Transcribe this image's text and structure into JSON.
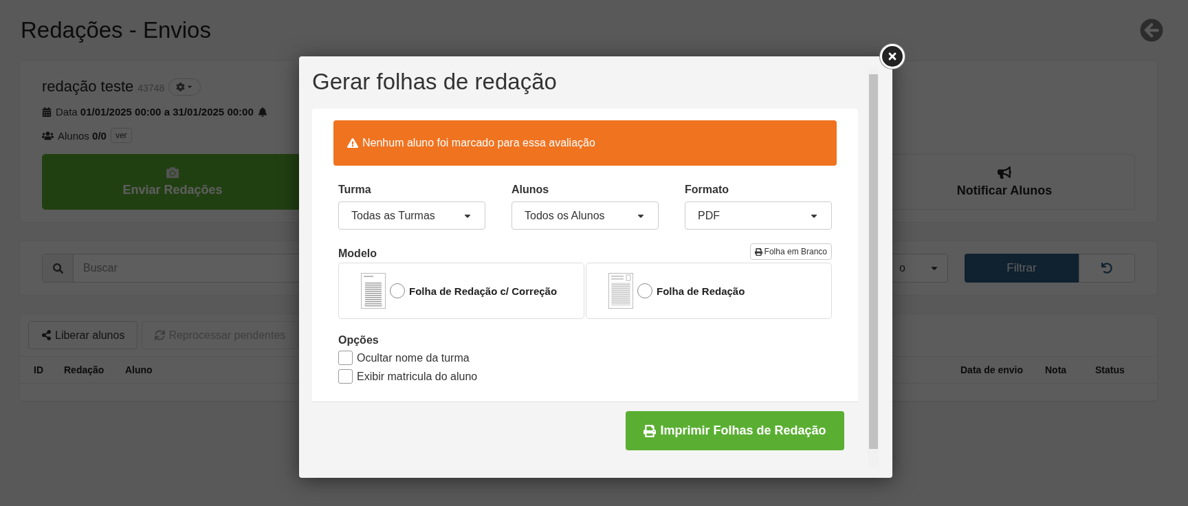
{
  "page": {
    "title": "Redações - Envios"
  },
  "assessment": {
    "name": "redação teste",
    "id": "43748",
    "date": "Data **01/01/2025 00:00 a 31/01/2025 00:00**",
    "students": "Alunos **0/0**",
    "view_button": "ver"
  },
  "action_buttons": [
    {
      "kind": "primary",
      "label": "Enviar Redações"
    },
    {
      "kind": "default",
      "label": "Notificar Alunos"
    }
  ],
  "filters": {
    "search_placeholder": "Buscar",
    "select_value": "o",
    "filter_button": "Filtrar"
  },
  "toolbar": [
    {
      "label": "Liberar alunos",
      "disabled": false
    },
    {
      "label": "Reprocessar pendentes",
      "disabled": true
    }
  ],
  "table": {
    "columns": [
      "ID",
      "Redação",
      "Aluno",
      "Data de envio",
      "Nota",
      "Status"
    ]
  },
  "modal": {
    "title": "Gerar folhas de redação",
    "alert": "Nenhum aluno foi marcado para essa avaliação",
    "fields": [
      {
        "label": "Turma",
        "value": "Todas as Turmas"
      },
      {
        "label": "Alunos",
        "value": "Todos os Alunos"
      },
      {
        "label": "Formato",
        "value": "PDF"
      }
    ],
    "model_label": "Modelo",
    "blank_sheet_button": "Folha em Branco",
    "models": [
      {
        "kind": "correction",
        "label": "Folha de Redação c/ Correção",
        "selected": false
      },
      {
        "kind": "plain",
        "label": "Folha de Redação",
        "selected": false
      }
    ],
    "options_label": "Opções",
    "options": [
      {
        "label": "Ocultar nome da turma",
        "checked": false
      },
      {
        "label": "Exibir matricula do aluno",
        "checked": false
      }
    ],
    "print_button": "Imprimir Folhas de Redação"
  }
}
